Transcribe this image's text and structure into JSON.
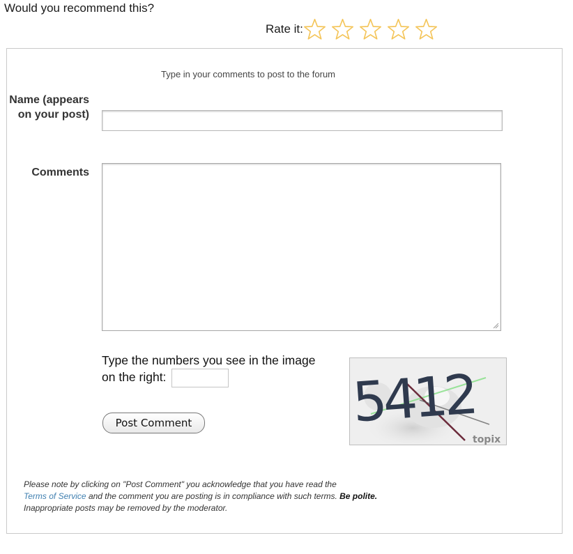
{
  "recommend": {
    "question": "Would you recommend this?"
  },
  "rating": {
    "label": "Rate it:",
    "stars_total": 5,
    "stars_filled": 0,
    "star_color": "#f4c55a"
  },
  "form": {
    "instructions": "Type in your comments to post to the forum",
    "name_label": "Name (appears on your post)",
    "name_value": "",
    "comments_label": "Comments",
    "comments_value": "",
    "captcha_prompt": "Type the numbers you see in the image on the right:",
    "captcha_value": "",
    "captcha_code": "5412",
    "captcha_brand": "topix",
    "post_button": "Post Comment"
  },
  "notice": {
    "before_link": "Please note by clicking on \"Post Comment\" you acknowledge that you have read the",
    "link_text": "Terms of Service",
    "after_link": "and the comment you are posting is in compliance with such terms.",
    "bold_text": "Be polite.",
    "trailing": "Inappropriate posts may be removed by the moderator."
  }
}
